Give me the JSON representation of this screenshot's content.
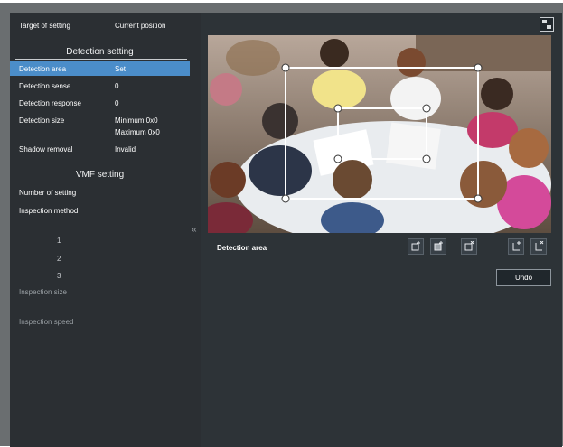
{
  "target": {
    "label": "Target of setting",
    "value": "Current position"
  },
  "detection": {
    "title": "Detection setting",
    "rows": [
      {
        "label": "Detection area",
        "value": "Set"
      },
      {
        "label": "Detection sense",
        "value": "0"
      },
      {
        "label": "Detection response",
        "value": "0"
      },
      {
        "label": "Detection size",
        "value_min": "Minimum 0x0",
        "value_max": "Maximum 0x0"
      },
      {
        "label": "Shadow removal",
        "value": "Invalid"
      }
    ]
  },
  "vmf": {
    "title": "VMF setting",
    "number_of_setting": "Number of setting",
    "inspection_method": "Inspection method",
    "methods": [
      "1",
      "2",
      "3"
    ],
    "inspection_size": "Inspection size",
    "inspection_speed": "Inspection speed"
  },
  "collapse_glyph": "«",
  "preview": {
    "area_label": "Detection area",
    "undo_label": "Undo",
    "tool_icons": [
      "add-area-icon",
      "add-mask-icon",
      "delete-area-icon",
      "add-vertex-icon",
      "delete-vertex-icon"
    ],
    "expand_icon": "expand-icon"
  },
  "colors": {
    "selection": "#4b8dc9",
    "panel": "#2b2f33",
    "frame": "#6a6e70"
  }
}
